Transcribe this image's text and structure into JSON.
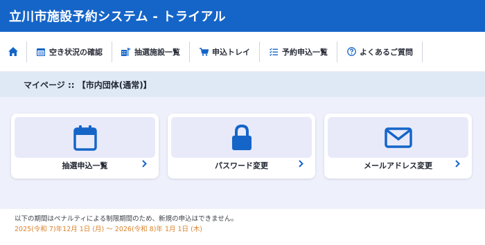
{
  "header": {
    "title": "立川市施設予約システム - トライアル"
  },
  "nav": {
    "items": [
      {
        "label": "空き状況の確認",
        "icon": "calendar-grid-icon"
      },
      {
        "label": "抽選施設一覧",
        "icon": "building-flag-icon"
      },
      {
        "label": "申込トレイ",
        "icon": "cart-icon"
      },
      {
        "label": "予約申込一覧",
        "icon": "checklist-icon"
      },
      {
        "label": "よくあるご質問",
        "icon": "question-circle-icon"
      }
    ]
  },
  "breadcrumb": {
    "text": "マイページ :: 【市内団体(通常)】"
  },
  "cards": [
    {
      "label": "抽選申込一覧",
      "icon": "calendar-icon"
    },
    {
      "label": "パスワード変更",
      "icon": "lock-icon"
    },
    {
      "label": "メールアドレス変更",
      "icon": "envelope-icon"
    }
  ],
  "notice": {
    "message": "以下の期間はペナルティによる制限期間のため、新規の申込はできません。",
    "period": "2025(令和 7)年12月 1日 (月) 〜 2026(令和 8)年 1月 1日 (木)"
  },
  "colors": {
    "brand": "#1565c8",
    "accent_text": "#d9822b",
    "icon": "#1565c8"
  }
}
